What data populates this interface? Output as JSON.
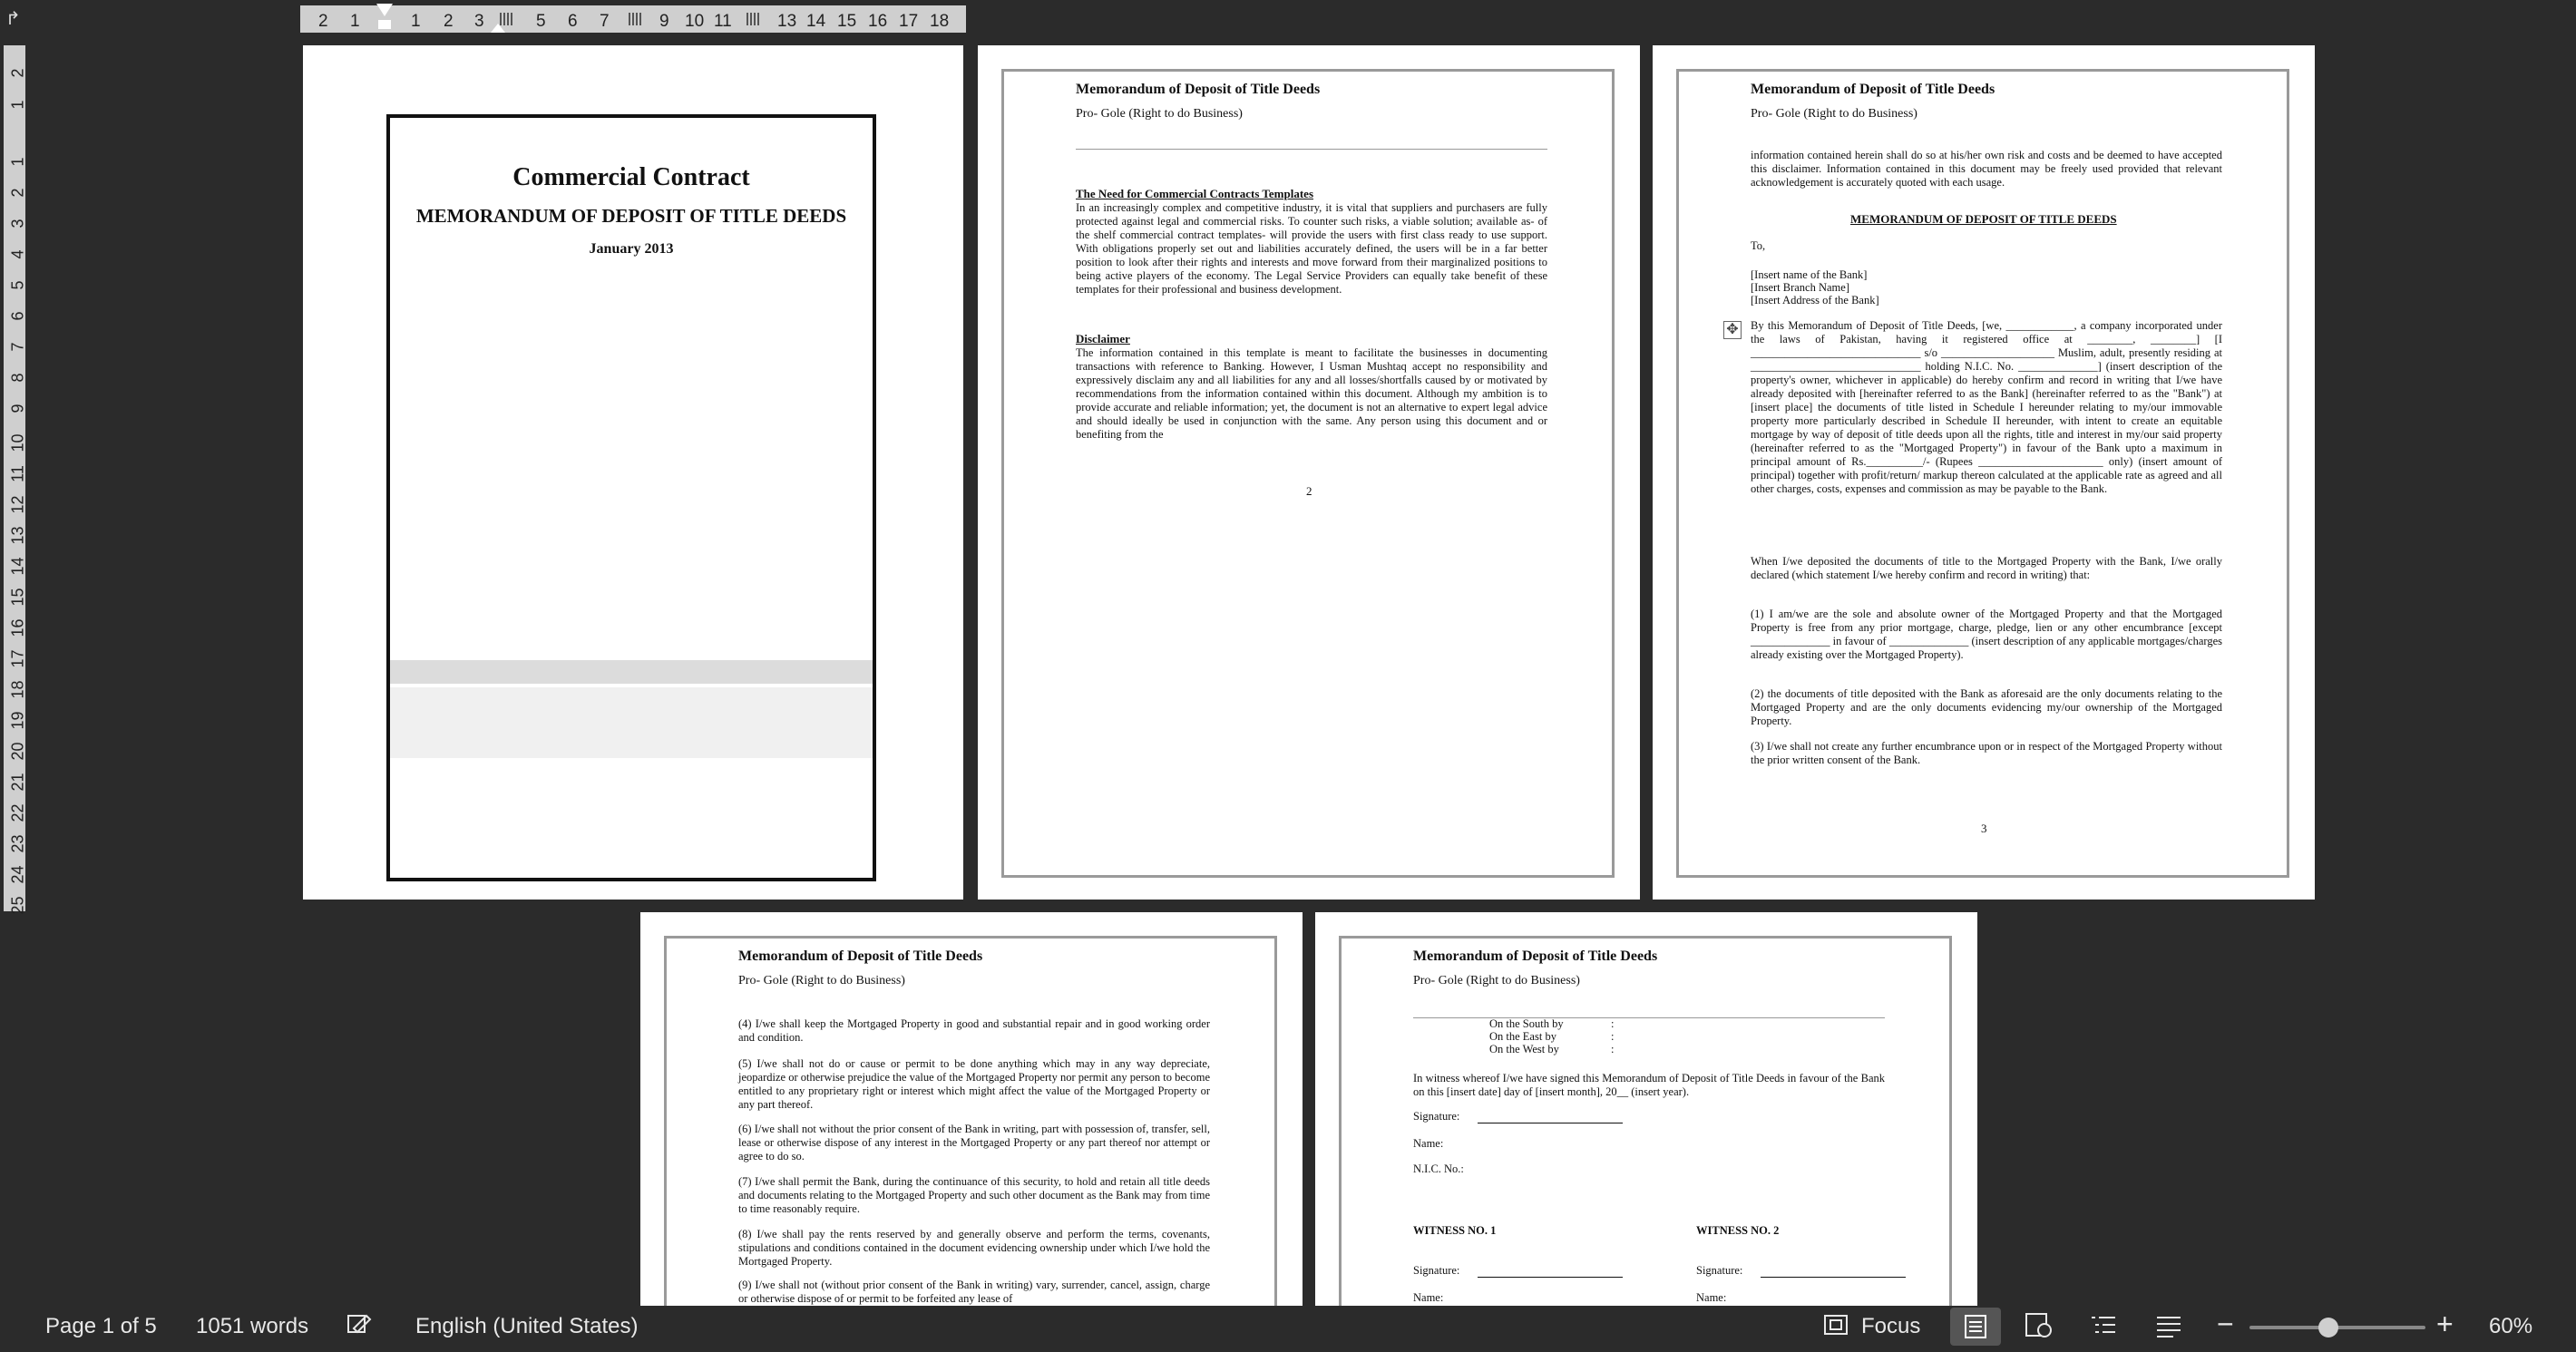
{
  "ruler": {
    "h_labels": [
      "2",
      "1",
      "1",
      "2",
      "3",
      "5",
      "6",
      "7",
      "9",
      "10",
      "11",
      "13",
      "14",
      "15",
      "16",
      "17",
      "18"
    ],
    "v_labels": [
      "2",
      "1",
      "1",
      "2",
      "3",
      "4",
      "5",
      "6",
      "7",
      "8",
      "9",
      "10",
      "11",
      "12",
      "13",
      "14",
      "15",
      "16",
      "17",
      "18",
      "19",
      "20",
      "21",
      "22",
      "23",
      "24",
      "25"
    ]
  },
  "doc": {
    "header_title": "Memorandum of Deposit of Title Deeds",
    "header_sub": "Pro- Gole (Right to do Business)"
  },
  "cover": {
    "title": "Commercial Contract",
    "subtitle": "MEMORANDUM OF DEPOSIT OF TITLE DEEDS",
    "date": "January 2013"
  },
  "page2": {
    "h1": "The Need for Commercial Contracts Templates",
    "p1": "In an increasingly complex and competitive industry, it is vital that suppliers and purchasers are fully protected against legal and commercial risks. To counter such risks, a viable solution; available as- of the shelf commercial contract templates- will provide the users with first class ready to use support. With obligations properly set out and liabilities accurately defined, the users will be in a far better position to look after their rights and interests and move forward from their marginalized positions to being active players of the economy. The Legal Service Providers can equally take benefit of these templates for their professional and business development.",
    "h2": "Disclaimer",
    "p2": "The information contained in this template is meant to facilitate the businesses in documenting transactions with reference to Banking. However, I Usman Mushtaq accept no responsibility and expressively disclaim any and all liabilities for any and all losses/shortfalls caused by or motivated by recommendations from the information contained within this document. Although my ambition is to provide accurate and reliable information; yet, the document is not an alternative to expert legal advice and should ideally be used in conjunction with the same. Any person using this document and or benefiting from the",
    "num": "2"
  },
  "page3": {
    "p0": "information contained herein shall do so at his/her own risk and costs and be deemed to have accepted this disclaimer. Information contained in this document may be freely used provided that relevant acknowledgement is accurately quoted with each usage.",
    "heading": "MEMORANDUM OF DEPOSIT OF TITLE DEEDS",
    "to": "To,",
    "bank1": "[Insert name of the Bank]",
    "bank2": "[Insert Branch Name]",
    "bank3": "[Insert Address of the Bank]",
    "p1": "By this Memorandum of Deposit of Title Deeds, [we, ____________, a company incorporated under the laws of Pakistan, having it registered office at ________, ________] [I ______________________________ s/o ____________________ Muslim, adult, presently residing at ______________________________ holding N.I.C. No. ______________] (insert description of the property's owner, whichever in applicable) do hereby confirm and record in writing that I/we have already deposited with [hereinafter referred to as the Bank] (hereinafter referred to as the \"Bank\") at [insert place] the documents of title listed in Schedule I hereunder relating to my/our immovable property more particularly described in Schedule II hereunder, with intent to create an equitable mortgage by way of deposit of title deeds upon all the rights, title and interest in my/our said property (hereinafter referred to as the \"Mortgaged Property\") in favour of the Bank upto a maximum in principal amount of Rs.__________/- (Rupees ______________________ only) (insert amount of principal) together with profit/return/ markup thereon calculated at the applicable rate as agreed and all other charges, costs, expenses and commission as may be payable to the Bank.",
    "p2": "When I/we deposited the documents of title to the Mortgaged Property with the Bank, I/we orally declared (which statement I/we hereby confirm and record in writing) that:",
    "p3": "(1) I am/we are the sole and absolute owner of the Mortgaged Property and that the Mortgaged Property is free from any prior mortgage, charge, pledge, lien or any other encumbrance [except ______________ in favour of ______________ (insert description of any applicable mortgages/charges already existing over the Mortgaged Property).",
    "p4": "(2) the documents of title deposited with the Bank as aforesaid are the only documents relating to the Mortgaged Property and are the only documents evidencing my/our ownership of the Mortgaged Property.",
    "p5": "(3) I/we shall not create any further encumbrance upon or in respect of the Mortgaged Property without the prior written consent of the Bank.",
    "num": "3"
  },
  "page4": {
    "p4": "(4) I/we shall keep the Mortgaged Property in good and substantial repair and in good working order and condition.",
    "p5": "(5) I/we shall not do or cause or permit to be done anything which may in any way depreciate, jeopardize or otherwise prejudice the value of the Mortgaged Property nor permit any person to become entitled to any proprietary right or interest which might affect the value of the Mortgaged Property or any part thereof.",
    "p6": "(6) I/we shall not without the prior consent of the Bank in writing, part with possession of, transfer, sell, lease or otherwise dispose of any interest in the Mortgaged Property or any part thereof nor attempt or agree to do so.",
    "p7": "(7) I/we shall permit the Bank, during the continuance of this security, to hold and retain all title deeds and documents relating to the Mortgaged Property and such other document as the Bank may from time to time reasonably require.",
    "p8": "(8) I/we shall pay the rents reserved by and generally observe and perform the terms, covenants, stipulations and conditions contained in the document evidencing ownership under which I/we hold the Mortgaged Property.",
    "p9": "(9) I/we shall not (without prior consent of the Bank in writing) vary, surrender, cancel, assign, charge or otherwise dispose of or permit to be forfeited any lease of"
  },
  "page5": {
    "south": "On the South by",
    "east": "On the East by",
    "west": "On the West by",
    "colon": ":",
    "witness": "In witness whereof I/we have signed this Memorandum of Deposit of Title Deeds in favour of the Bank on this [insert date] day of [insert month], 20__ (insert year).",
    "signature": "Signature:",
    "name": "Name:",
    "nic": "N.I.C. No.:",
    "w1": "WITNESS NO. 1",
    "w2": "WITNESS NO. 2"
  },
  "status": {
    "page": "Page 1 of 5",
    "words": "1051 words",
    "language": "English (United States)",
    "focus": "Focus",
    "zoom_minus": "−",
    "zoom_plus": "+",
    "zoom": "60%",
    "zoom_level": 0.45
  }
}
